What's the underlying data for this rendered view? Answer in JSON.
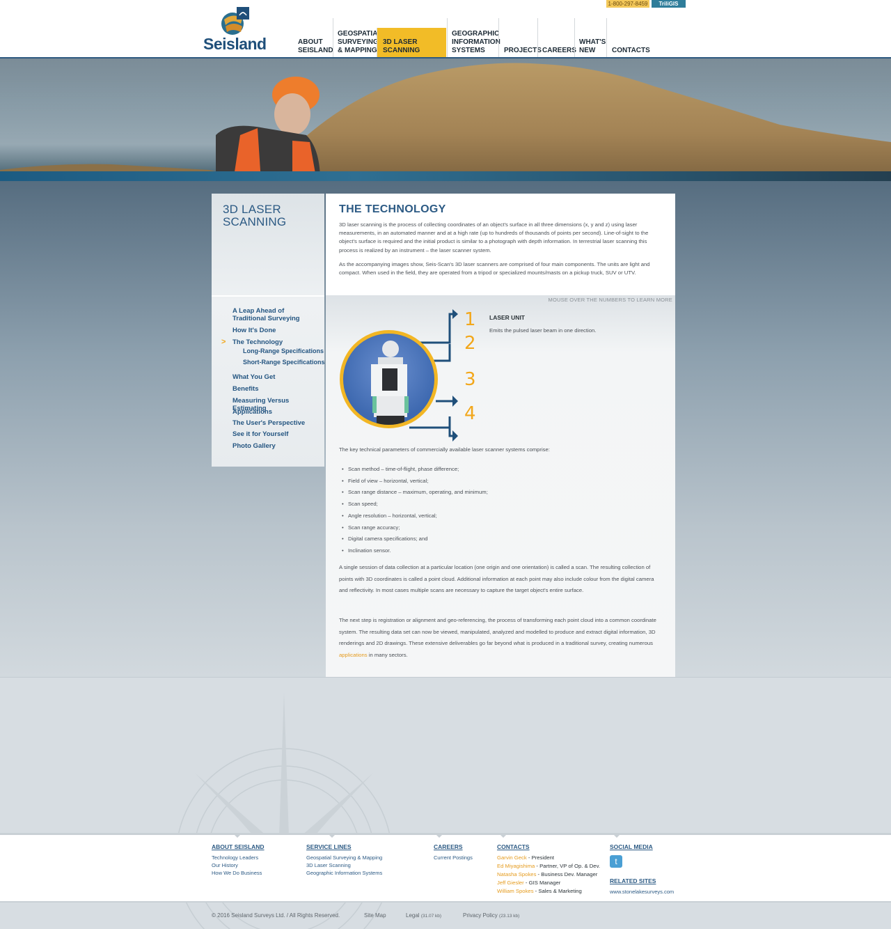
{
  "topbar": {
    "phone": "1-800-297-8459",
    "login": "TriliGIS Login",
    "logo_text": "Seisland"
  },
  "nav": [
    {
      "line1": "ABOUT",
      "line2": "SEISLAND"
    },
    {
      "line1": "GEOSPATIAL",
      "line2": "SURVEYING",
      "line3": "& MAPPING"
    },
    {
      "line1": "3D LASER SCANNING"
    },
    {
      "line1": "GEOGRAPHIC",
      "line2": "INFORMATION",
      "line3": "SYSTEMS"
    },
    {
      "line1": "PROJECTS"
    },
    {
      "line1": "CAREERS"
    },
    {
      "line1": "WHAT'S",
      "line2": "NEW"
    },
    {
      "line1": "CONTACTS"
    }
  ],
  "sidebar": {
    "title": "3D LASER SCANNING",
    "items": [
      {
        "label": "A Leap Ahead of Traditional Surveying"
      },
      {
        "label": "How It's Done"
      },
      {
        "label": "The Technology"
      },
      {
        "label": "Long-Range Specifications"
      },
      {
        "label": "Short-Range Specifications"
      },
      {
        "label": "What You Get"
      },
      {
        "label": "Benefits"
      },
      {
        "label": "Measuring Versus Estimating"
      },
      {
        "label": "Applications"
      },
      {
        "label": "The User's Perspective"
      },
      {
        "label": "See it for Yourself"
      },
      {
        "label": "Photo Gallery"
      }
    ],
    "active_marker": ">"
  },
  "main": {
    "title": "THE TECHNOLOGY",
    "para1": "3D laser scanning is the process of collecting coordinates of an object's surface in all three dimensions (x, y and z) using laser measurements, in an automated manner and at a high rate (up to hundreds of thousands of points per second). Line-of-sight to the object's surface is required and the initial product is similar to a photograph with depth information. In terrestrial laser scanning this process is realized by an instrument – the laser scanner system.",
    "para2": "As the accompanying images show, Seis-Scan's 3D laser scanners are comprised of four main components. The units are light and compact. When used in the field, they are operated from a tripod or specialized mounts/masts on a pickup truck, SUV or UTV.",
    "mouseover": "MOUSE OVER THE NUMBERS TO LEARN MORE",
    "numbers": [
      "1",
      "2",
      "3",
      "4"
    ],
    "component_title": "LASER UNIT",
    "component_desc": "Emits the pulsed laser beam in one direction.",
    "params_intro": "The key technical parameters of commercially available laser scanner systems comprise:",
    "bullets": [
      "Scan method – time-of-flight, phase difference;",
      "Field of view – horizontal, vertical;",
      "Scan range distance – maximum, operating, and minimum;",
      "Scan speed;",
      "Angle resolution – horizontal, vertical;",
      "Scan range accuracy;",
      "Digital camera specifications; and",
      "Inclination sensor."
    ],
    "para3": "A single session of data collection at a particular location (one origin and one orientation) is called a scan. The resulting collection of points with 3D coordinates is called a point cloud. Additional information at each point may also include colour from the digital camera and reflectivity. In most cases multiple scans are necessary to capture the target object's entire surface.",
    "para4_a": "The next step is registration or alignment and geo-referencing, the process of transforming each point cloud into a common coordinate system. The resulting data set can now be viewed, manipulated, analyzed and modelled to produce and extract digital information, 3D renderings and 2D drawings. These extensive deliverables go far beyond what is produced in a traditional survey, creating numerous",
    "para4_link": "applications",
    "para4_b": "in many sectors."
  },
  "footer": {
    "about": {
      "head": "ABOUT SEISLAND",
      "links": [
        "Technology Leaders",
        "Our History",
        "How We Do Business"
      ]
    },
    "services": {
      "head": "SERVICE LINES",
      "links": [
        "Geospatial Surveying & Mapping",
        "3D Laser Scanning",
        "Geographic Information Systems"
      ]
    },
    "careers": {
      "head": "CAREERS",
      "links": [
        "Current Postings"
      ]
    },
    "contacts": {
      "head": "CONTACTS",
      "people": [
        {
          "name": "Garvin Geck",
          "role": "President"
        },
        {
          "name": "Ed Miyagishima",
          "role": "Partner, VP of Op. & Dev."
        },
        {
          "name": "Natasha Spokes",
          "role": "Business Dev. Manager"
        },
        {
          "name": "Jeff Giesler",
          "role": "GIS Manager"
        },
        {
          "name": "William Spokes",
          "role": "Sales & Marketing"
        }
      ]
    },
    "social": {
      "head": "SOCIAL MEDIA",
      "icon": "twitter-icon"
    },
    "related": {
      "head": "RELATED SITES",
      "link": "www.stonelakesurveys.com"
    },
    "copyright": "© 2016 Seisland Surveys Ltd. / All Rights Reserved.",
    "sitemap": "Site Map",
    "legal": "Legal",
    "legal_size": "(31.07 kb)",
    "privacy": "Privacy Policy",
    "privacy_size": "(23.13 kb)"
  },
  "colors": {
    "accent": "#f2bc27",
    "brand_blue": "#2c5a84",
    "link_orange": "#e59b1d"
  }
}
